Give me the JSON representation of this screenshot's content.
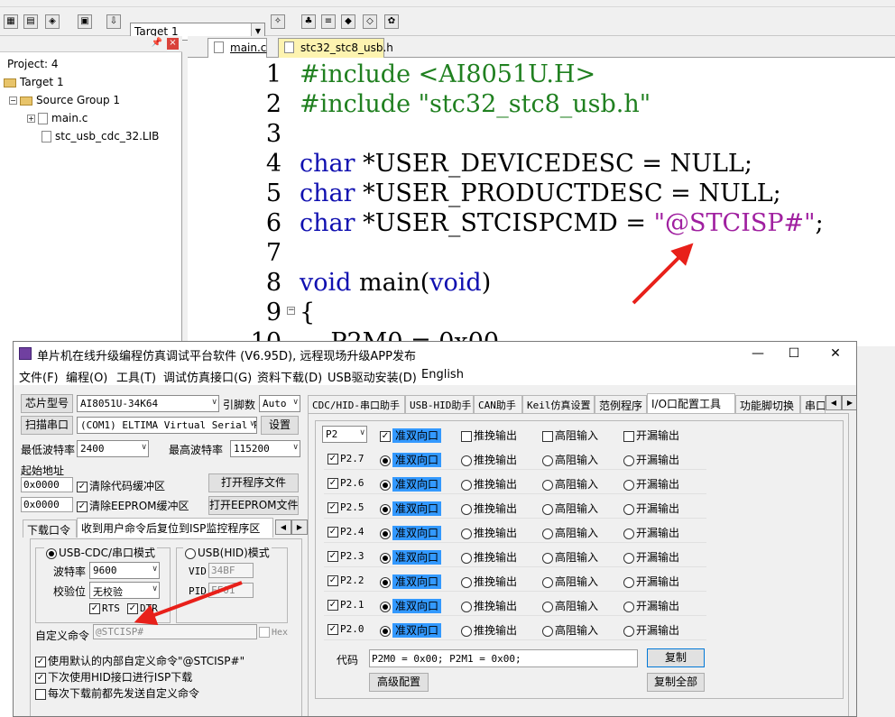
{
  "ide": {
    "target": "Target 1",
    "project_panel": {
      "root": "Project: 4",
      "target": "Target 1",
      "group": "Source Group 1",
      "files": [
        "main.c",
        "stc_usb_cdc_32.LIB"
      ]
    },
    "tabs": [
      "main.c",
      "stc32_stc8_usb.h"
    ],
    "code_lines": [
      {
        "n": "1",
        "parts": [
          {
            "t": "#include <AI8051U.H>",
            "c": "pp"
          }
        ]
      },
      {
        "n": "2",
        "parts": [
          {
            "t": "#include \"stc32_stc8_usb.h\"",
            "c": "pp"
          }
        ]
      },
      {
        "n": "3",
        "parts": []
      },
      {
        "n": "4",
        "parts": [
          {
            "t": "char",
            "c": "kw"
          },
          {
            "t": " *USER_DEVICEDESC = NULL;",
            "c": ""
          }
        ]
      },
      {
        "n": "5",
        "parts": [
          {
            "t": "char",
            "c": "kw"
          },
          {
            "t": " *USER_PRODUCTDESC = NULL;",
            "c": ""
          }
        ]
      },
      {
        "n": "6",
        "parts": [
          {
            "t": "char",
            "c": "kw"
          },
          {
            "t": " *USER_STCISPCMD = ",
            "c": ""
          },
          {
            "t": "\"@STCISP#\"",
            "c": "str"
          },
          {
            "t": ";",
            "c": ""
          }
        ]
      },
      {
        "n": "7",
        "parts": []
      },
      {
        "n": "8",
        "parts": [
          {
            "t": "void",
            "c": "kw"
          },
          {
            "t": " main(",
            "c": ""
          },
          {
            "t": "void",
            "c": "kw"
          },
          {
            "t": ")",
            "c": ""
          }
        ]
      },
      {
        "n": "9",
        "parts": [
          {
            "t": "{",
            "c": ""
          }
        ]
      },
      {
        "n": "10",
        "parts": [
          {
            "t": "    P2M0 = 0x00",
            "c": ""
          }
        ]
      }
    ]
  },
  "stc": {
    "title": "单片机在线升级编程仿真调试平台软件 (V6.95D), 远程现场升级APP发布",
    "menu": [
      "文件(F)",
      "编程(O)",
      "工具(T)",
      "调试仿真接口(G)",
      "资料下载(D)",
      "USB驱动安装(D)",
      "English"
    ],
    "chip_label": "芯片型号",
    "chip_value": "AI8051U-34K64",
    "pins_label": "引脚数",
    "pins_value": "Auto",
    "scan_button": "扫描串口",
    "port_value": "(COM1) ELTIMA Virtual Serial P",
    "settings_button": "设置",
    "min_baud_label": "最低波特率",
    "min_baud_value": "2400",
    "max_baud_label": "最高波特率",
    "max_baud_value": "115200",
    "start_addr_label": "起始地址",
    "addr1": "0x0000",
    "clear_code_label": "清除代码缓冲区",
    "open_prog_button": "打开程序文件",
    "addr2": "0x0000",
    "clear_eeprom_label": "清除EEPROM缓冲区",
    "open_eeprom_button": "打开EEPROM文件",
    "left_tabs": [
      "下载口令",
      "收到用户命令后复位到ISP监控程序区"
    ],
    "usb_cdc_mode": "USB-CDC/串口模式",
    "usb_hid_mode": "USB(HID)模式",
    "baud_label": "波特率",
    "baud_value": "9600",
    "parity_label": "校验位",
    "parity_value": "无校验",
    "vid_label": "VID",
    "vid_value": "34BF",
    "pid_label": "PID",
    "pid_value": "FF01",
    "rts_label": "RTS",
    "dtr_label": "DTR",
    "custom_cmd_label": "自定义命令",
    "custom_cmd_value": "@STCISP#",
    "hex_label": "Hex",
    "opt1": "使用默认的内部自定义命令\"@STCISP#\"",
    "opt2": "下次使用HID接口进行ISP下载",
    "opt3": "每次下载前都先发送自定义命令",
    "right_tabs": [
      "CDC/HID-串口助手",
      "USB-HID助手",
      "CAN助手",
      "Keil仿真设置",
      "范例程序",
      "I/O口配置工具",
      "功能脚切换",
      "串口"
    ],
    "port_select": "P2",
    "io_modes": [
      "准双向口",
      "推挽输出",
      "高阻输入",
      "开漏输出"
    ],
    "pins": [
      "P2.7",
      "P2.6",
      "P2.5",
      "P2.4",
      "P2.3",
      "P2.2",
      "P2.1",
      "P2.0"
    ],
    "code_label": "代码",
    "code_value": "P2M0 = 0x00; P2M1 = 0x00;",
    "copy_button": "复制",
    "advanced_button": "高级配置",
    "copy_all_button": "复制全部"
  },
  "arrow_color": "#e8201a"
}
